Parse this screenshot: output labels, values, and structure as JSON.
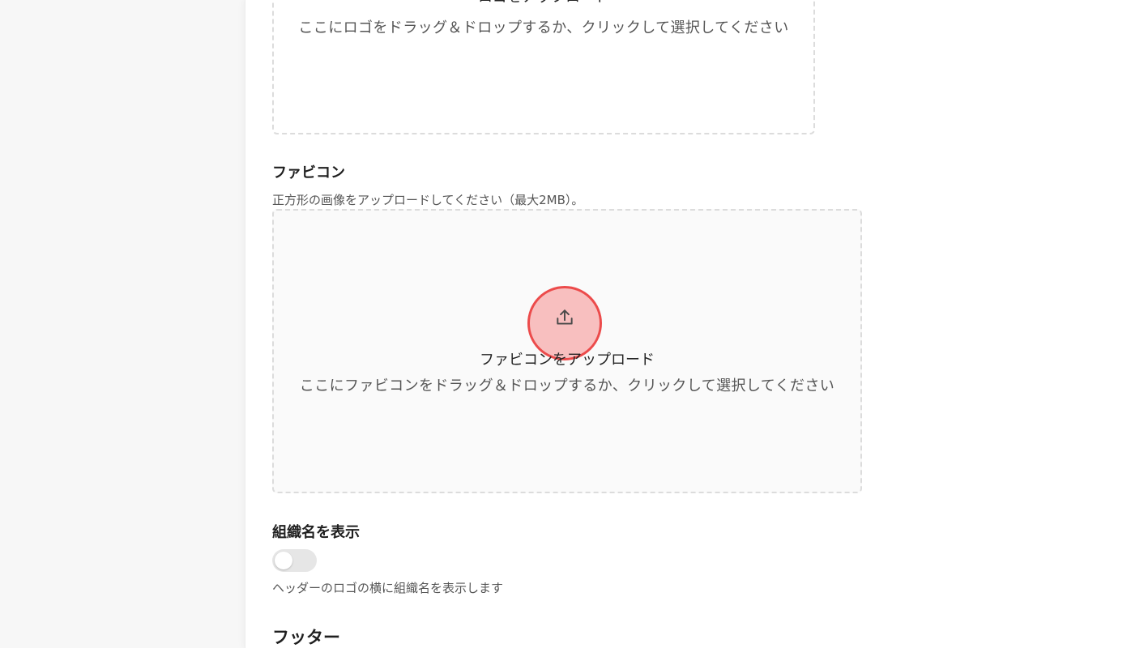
{
  "logo": {
    "upload_title": "ロゴをアップロード",
    "upload_hint": "ここにロゴをドラッグ＆ドロップするか、クリックして選択してください"
  },
  "favicon": {
    "label": "ファビコン",
    "description": "正方形の画像をアップロードしてください（最大2MB）。",
    "upload_title": "ファビコンをアップロード",
    "upload_hint": "ここにファビコンをドラッグ＆ドロップするか、クリックして選択してください",
    "icon": "upload-icon"
  },
  "show_org_name": {
    "label": "組織名を表示",
    "enabled": false,
    "description": "ヘッダーのロゴの横に組織名を表示します"
  },
  "footer": {
    "heading": "フッター"
  },
  "colors": {
    "highlight_fill": "#f7a0a0",
    "highlight_border": "#ec4b4b",
    "toggle_off": "#e6e6e6"
  }
}
